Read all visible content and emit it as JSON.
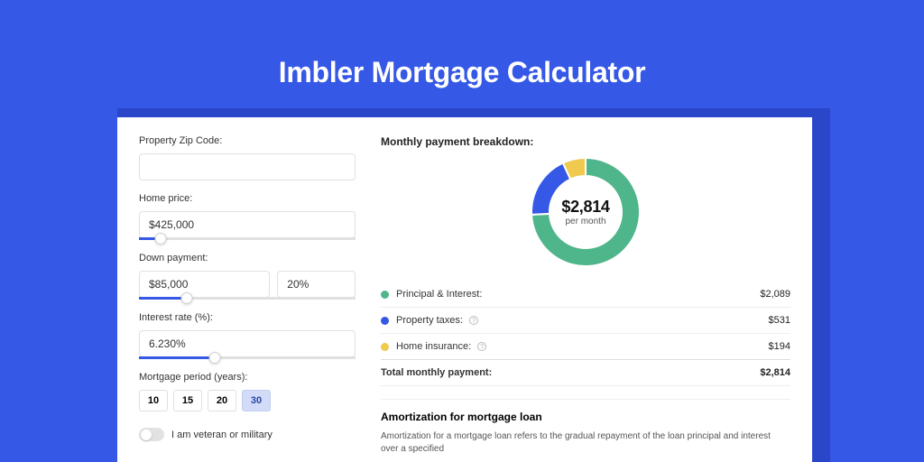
{
  "title": "Imbler Mortgage Calculator",
  "form": {
    "zip_label": "Property Zip Code:",
    "zip_value": "",
    "home_label": "Home price:",
    "home_value": "$425,000",
    "dp_label": "Down payment:",
    "dp_value": "$85,000",
    "dp_pct": "20%",
    "rate_label": "Interest rate (%):",
    "rate_value": "6.230%",
    "period_label": "Mortgage period (years):",
    "periods": [
      "10",
      "15",
      "20",
      "30"
    ],
    "period_selected": "30",
    "veteran_label": "I am veteran or military"
  },
  "breakdown": {
    "title": "Monthly payment breakdown:",
    "center_amount": "$2,814",
    "center_sub": "per month",
    "items": [
      {
        "label": "Principal & Interest:",
        "value": "$2,089",
        "color": "#4fb58a",
        "info": false
      },
      {
        "label": "Property taxes:",
        "value": "$531",
        "color": "#3558e6",
        "info": true
      },
      {
        "label": "Home insurance:",
        "value": "$194",
        "color": "#f0c94f",
        "info": true
      }
    ],
    "total_label": "Total monthly payment:",
    "total_value": "$2,814"
  },
  "amortization": {
    "title": "Amortization for mortgage loan",
    "text": "Amortization for a mortgage loan refers to the gradual repayment of the loan principal and interest over a specified"
  },
  "chart_data": {
    "type": "pie",
    "title": "Monthly payment breakdown",
    "series": [
      {
        "name": "Principal & Interest",
        "value": 2089,
        "color": "#4fb58a"
      },
      {
        "name": "Property taxes",
        "value": 531,
        "color": "#3558e6"
      },
      {
        "name": "Home insurance",
        "value": 194,
        "color": "#f0c94f"
      }
    ],
    "total": 2814,
    "unit": "$ per month"
  }
}
